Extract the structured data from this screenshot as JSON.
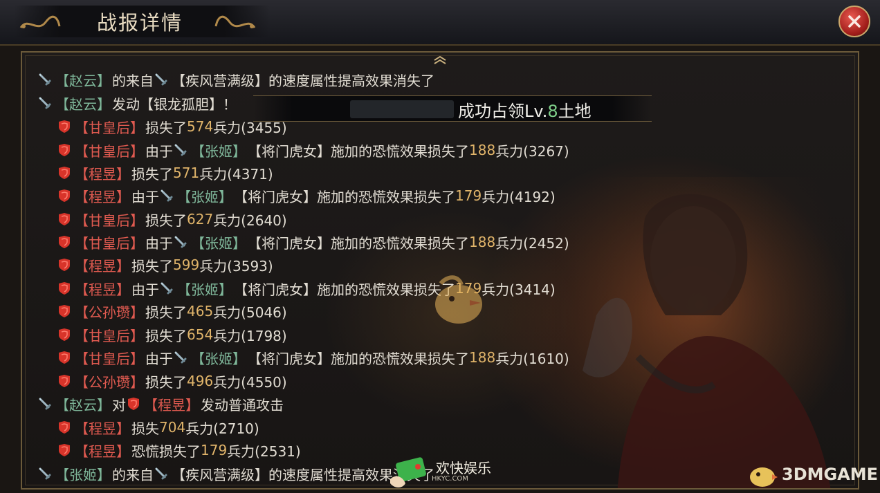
{
  "header": {
    "title": "战报详情"
  },
  "banner": {
    "prefix": "成功占领Lv.",
    "level": "8",
    "suffix": "土地"
  },
  "logs": [
    {
      "side": "ally",
      "name": "【赵云】",
      "text": "的来自",
      "has_icon2": true,
      "skill": "【疾风营满级】",
      "rest": "的速度属性提高效果消失了"
    },
    {
      "side": "ally",
      "name": "【赵云】",
      "text": "发动【银龙孤胆】！"
    },
    {
      "side": "enemy",
      "name": "【甘皇后】",
      "pre": "损失了",
      "num": "574",
      "post": "兵力(3455)"
    },
    {
      "side": "enemy",
      "name": "【甘皇后】",
      "pre": "由于",
      "src": "【张姬】",
      "skill": "【将门虎女】施加的恐慌效果损失了",
      "num": "188",
      "post": "兵力(3267)"
    },
    {
      "side": "enemy",
      "name": "【程昱】",
      "pre": "损失了",
      "num": "571",
      "post": "兵力(4371)"
    },
    {
      "side": "enemy",
      "name": "【程昱】",
      "pre": "由于",
      "src": "【张姬】",
      "skill": "【将门虎女】施加的恐慌效果损失了",
      "num": "179",
      "post": "兵力(4192)"
    },
    {
      "side": "enemy",
      "name": "【甘皇后】",
      "pre": "损失了",
      "num": "627",
      "post": "兵力(2640)"
    },
    {
      "side": "enemy",
      "name": "【甘皇后】",
      "pre": "由于",
      "src": "【张姬】",
      "skill": "【将门虎女】施加的恐慌效果损失了",
      "num": "188",
      "post": "兵力(2452)"
    },
    {
      "side": "enemy",
      "name": "【程昱】",
      "pre": "损失了",
      "num": "599",
      "post": "兵力(3593)"
    },
    {
      "side": "enemy",
      "name": "【程昱】",
      "pre": "由于",
      "src": "【张姬】",
      "skill": "【将门虎女】施加的恐慌效果损失了",
      "num": "179",
      "post": "兵力(3414)"
    },
    {
      "side": "enemy",
      "name": "【公孙瓒】",
      "pre": "损失了",
      "num": "465",
      "post": "兵力(5046)"
    },
    {
      "side": "enemy",
      "name": "【甘皇后】",
      "pre": "损失了",
      "num": "654",
      "post": "兵力(1798)"
    },
    {
      "side": "enemy",
      "name": "【甘皇后】",
      "pre": "由于",
      "src": "【张姬】",
      "skill": "【将门虎女】施加的恐慌效果损失了",
      "num": "188",
      "post": "兵力(1610)"
    },
    {
      "side": "enemy",
      "name": "【公孙瓒】",
      "pre": "损失了",
      "num": "496",
      "post": "兵力(4550)"
    },
    {
      "side": "ally",
      "name": "【赵云】",
      "text": "对",
      "target": "【程昱】",
      "rest": "发动普通攻击"
    },
    {
      "side": "enemy",
      "name": "【程昱】",
      "pre": "损失",
      "num": "704",
      "post": "兵力(2710)"
    },
    {
      "side": "enemy",
      "name": "【程昱】",
      "pre": "恐慌损失了",
      "num": "179",
      "post": "兵力(2531)"
    },
    {
      "side": "ally",
      "name": "【张姬】",
      "text": "的来自",
      "has_icon2": true,
      "skill": "【疾风营满级】",
      "rest": "的速度属性提高效果消失了"
    }
  ],
  "watermark": {
    "center": "",
    "bottom_main": "欢快娱乐",
    "bottom_sub": "HKYC.COM",
    "brand": "3DMGAME"
  },
  "colors": {
    "ally_name": "#7fb79a",
    "enemy_name": "#e05a50",
    "number": "#e0b46a",
    "text": "#e2ddd3"
  }
}
